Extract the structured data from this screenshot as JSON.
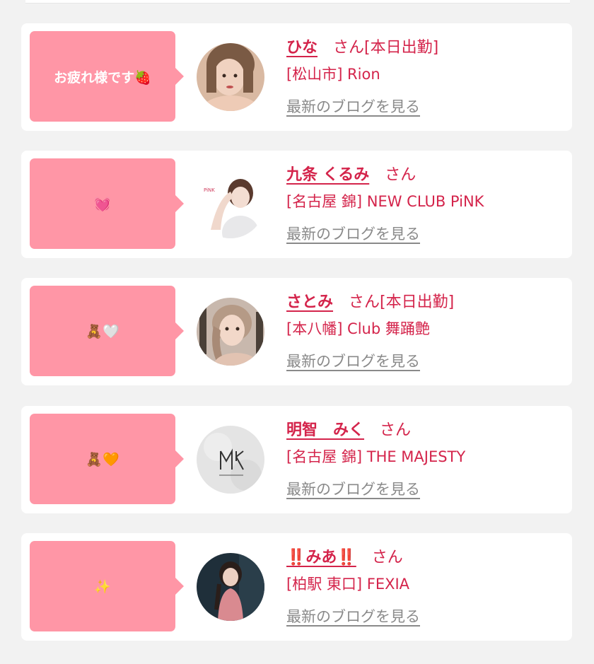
{
  "entries": [
    {
      "message": "お疲れ様です🍓",
      "name": "ひな",
      "honorific": "さん",
      "status": "[本日出勤]",
      "shop": "[松山市] Rion",
      "blog_link": "最新のブログを見る",
      "avatar_icon": "profile-photo-icon"
    },
    {
      "message": "💓",
      "name": "九条 くるみ",
      "honorific": "さん",
      "status": "",
      "shop": "[名古屋 錦] NEW CLUB PiNK",
      "blog_link": "最新のブログを見る",
      "avatar_icon": "profile-photo-icon"
    },
    {
      "message": "🧸🤍",
      "name": "さとみ",
      "honorific": "さん",
      "status": "[本日出勤]",
      "shop": "[本八幡] Club 舞踊艶",
      "blog_link": "最新のブログを見る",
      "avatar_icon": "profile-photo-icon"
    },
    {
      "message": "🧸🧡",
      "name": "明智　みく",
      "honorific": "さん",
      "status": "",
      "shop": "[名古屋 錦] THE MAJESTY",
      "blog_link": "最新のブログを見る",
      "avatar_icon": "shop-logo-icon"
    },
    {
      "message": "✨",
      "name": "‼️みあ‼️",
      "honorific": "さん",
      "status": "",
      "shop": "[柏駅 東口] FEXIA",
      "blog_link": "最新のブログを見る",
      "avatar_icon": "profile-photo-icon"
    }
  ],
  "colors": {
    "accent": "#d4244b",
    "bubble": "#ff96a6",
    "link_gray": "#8a8a8a",
    "background": "#f2f2f2"
  }
}
